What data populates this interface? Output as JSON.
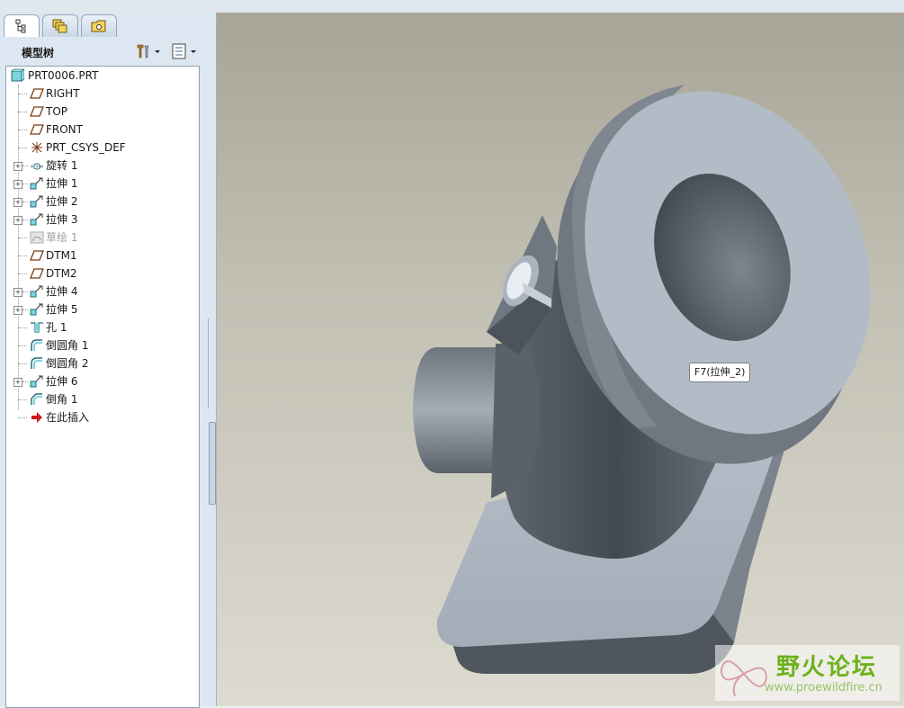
{
  "tabs": [
    {
      "name": "model-tree-tab",
      "icon": "model-tree-icon",
      "active": true
    },
    {
      "name": "layers-tab",
      "icon": "layers-icon",
      "active": false
    },
    {
      "name": "favorites-tab",
      "icon": "folder-icon",
      "active": false
    }
  ],
  "panel": {
    "title": "模型树",
    "settings_icon": "tools-settings-icon",
    "display_icon": "tree-display-icon"
  },
  "tree": {
    "items": [
      {
        "label": "PRT0006.PRT",
        "icon": "part-icon",
        "expandable": false,
        "dim": false
      },
      {
        "label": "RIGHT",
        "icon": "datum-plane-icon",
        "expandable": false,
        "dim": false
      },
      {
        "label": "TOP",
        "icon": "datum-plane-icon",
        "expandable": false,
        "dim": false
      },
      {
        "label": "FRONT",
        "icon": "datum-plane-icon",
        "expandable": false,
        "dim": false
      },
      {
        "label": "PRT_CSYS_DEF",
        "icon": "csys-icon",
        "expandable": false,
        "dim": false
      },
      {
        "label": "旋转 1",
        "icon": "revolve-icon",
        "expandable": true,
        "dim": false
      },
      {
        "label": "拉伸 1",
        "icon": "extrude-icon",
        "expandable": true,
        "dim": false
      },
      {
        "label": "拉伸 2",
        "icon": "extrude-icon",
        "expandable": true,
        "dim": false
      },
      {
        "label": "拉伸 3",
        "icon": "extrude-icon",
        "expandable": true,
        "dim": false
      },
      {
        "label": "草绘 1",
        "icon": "sketch-icon",
        "expandable": false,
        "dim": true
      },
      {
        "label": "DTM1",
        "icon": "datum-plane-icon",
        "expandable": false,
        "dim": false
      },
      {
        "label": "DTM2",
        "icon": "datum-plane-icon",
        "expandable": false,
        "dim": false
      },
      {
        "label": "拉伸 4",
        "icon": "extrude-icon",
        "expandable": true,
        "dim": false
      },
      {
        "label": "拉伸 5",
        "icon": "extrude-icon",
        "expandable": true,
        "dim": false
      },
      {
        "label": "孔 1",
        "icon": "hole-icon",
        "expandable": false,
        "dim": false
      },
      {
        "label": "倒圆角 1",
        "icon": "round-icon",
        "expandable": false,
        "dim": false
      },
      {
        "label": "倒圆角 2",
        "icon": "round-icon",
        "expandable": false,
        "dim": false
      },
      {
        "label": "拉伸 6",
        "icon": "extrude-icon",
        "expandable": true,
        "dim": false
      },
      {
        "label": "倒角 1",
        "icon": "chamfer-icon",
        "expandable": false,
        "dim": false
      },
      {
        "label": "在此插入",
        "icon": "insert-here-arrow-icon",
        "expandable": false,
        "dim": false
      }
    ]
  },
  "viewport": {
    "tooltip": "F7(拉伸_2)"
  },
  "watermark": {
    "title": "野火论坛",
    "url": "www.proewildfire.cn"
  },
  "colors": {
    "part_surface": "#9aa4ae",
    "part_face_light": "#b4bec8",
    "part_dark": "#4a5058",
    "watermark_green": "#6eb11d",
    "insert_arrow_red": "#d01818"
  }
}
